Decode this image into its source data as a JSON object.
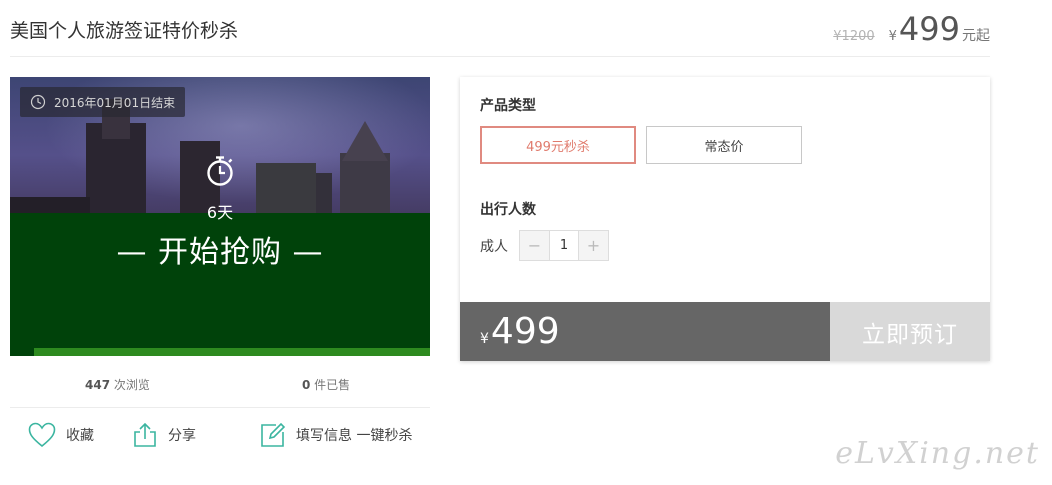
{
  "header": {
    "title": "美国个人旅游签证特价秒杀",
    "old_price": "¥1200",
    "currency": "¥",
    "price": "499",
    "price_unit": "元起"
  },
  "banner": {
    "end_date": "2016年01月01日结束",
    "countdown": "6天",
    "start_label": "— 开始抢购 —"
  },
  "stats": {
    "views": "447",
    "views_label": " 次浏览",
    "sold": "0",
    "sold_label": " 件已售"
  },
  "actions": {
    "favorite": "收藏",
    "share": "分享",
    "fill_info": "填写信息 一键秒杀"
  },
  "panel": {
    "product_type_label": "产品类型",
    "options": [
      "499元秒杀",
      "常态价"
    ],
    "travelers_label": "出行人数",
    "adult_label": "成人",
    "quantity": "1",
    "minus": "−",
    "plus": "+",
    "total_currency": "¥",
    "total": "499",
    "book_label": "立即预订"
  },
  "watermark": "eLvXing.net",
  "colors": {
    "accent": "#e07b6d",
    "green": "#00420a",
    "price_bar": "#666666",
    "book_button": "#d9d9d9",
    "icon_teal": "#3bb5a0"
  }
}
